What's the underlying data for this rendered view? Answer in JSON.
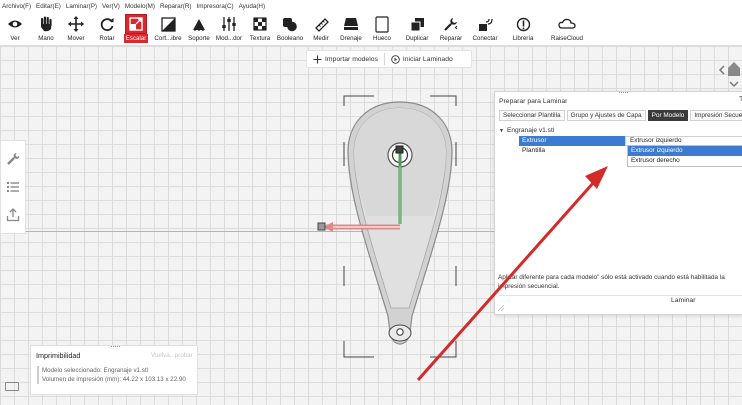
{
  "menu": [
    "Archivo(F)",
    "Editar(E)",
    "Laminar(P)",
    "Ver(V)",
    "Modelo(M)",
    "Reparar(R)",
    "Impresora(C)",
    "Ayuda(H)"
  ],
  "toolbar": [
    {
      "label": "Ver",
      "icon": "eye-icon"
    },
    {
      "label": "Mano",
      "icon": "hand-icon"
    },
    {
      "label": "Mover",
      "icon": "move-icon"
    },
    {
      "label": "Rotar",
      "icon": "rotate-icon"
    },
    {
      "label": "Escalar",
      "icon": "scale-icon"
    },
    {
      "label": "Cort...ibre",
      "icon": "cut-icon"
    },
    {
      "label": "Soporte",
      "icon": "support-icon"
    },
    {
      "label": "Mod...dor",
      "icon": "modifier-icon"
    },
    {
      "label": "Textura",
      "icon": "texture-icon"
    },
    {
      "label": "Booleano",
      "icon": "boolean-icon"
    },
    {
      "label": "Medir",
      "icon": "measure-icon"
    },
    {
      "label": "Drenaje",
      "icon": "drain-icon"
    },
    {
      "label": "Hueco",
      "icon": "hollow-icon"
    },
    {
      "label": "Duplicar",
      "icon": "duplicate-icon"
    },
    {
      "label": "Reparar",
      "icon": "repair-icon"
    },
    {
      "label": "Conectar",
      "icon": "connect-icon"
    },
    {
      "label": "Librería",
      "icon": "library-icon"
    },
    {
      "label": "RaiseCloud",
      "icon": "cloud-icon"
    }
  ],
  "actionbar": {
    "import_label": "Importar modelos",
    "slice_label": "Iniciar Laminado"
  },
  "panel": {
    "title": "Preparar para Laminar",
    "close": "T",
    "tabs": [
      {
        "label": "Seleccionar Plantilla"
      },
      {
        "label": "Grupo y Ajustes de Capa"
      },
      {
        "label": "Por Modelo"
      },
      {
        "label": "Impresión Secuenc"
      }
    ],
    "tree_root": "Engranaje v1.stl",
    "rows": [
      {
        "name": "Extrusor",
        "value": "Extrusor izquierdo"
      },
      {
        "name": "Plantilla",
        "value": ""
      }
    ],
    "dropdown_options": [
      "Extrusor izquierdo",
      "Extrusor derecho"
    ],
    "note": "Aplicar diferente para cada modelo\" sólo está activado cuando está habilitada la impresión secuencial.",
    "laminar_button": "Laminar"
  },
  "printability": {
    "title": "Imprimibilidad",
    "action": "Vuelva...probar",
    "model_line": "Modelo seleccionado: Engranaje v1.stl",
    "volume_line": "Volumen de impresión (mm): 44.22 x 103.13 x 22.90"
  },
  "colors": {
    "accent": "#d9282f",
    "selection": "#3d7bd1",
    "annotation_arrow": "#d42a2a"
  }
}
